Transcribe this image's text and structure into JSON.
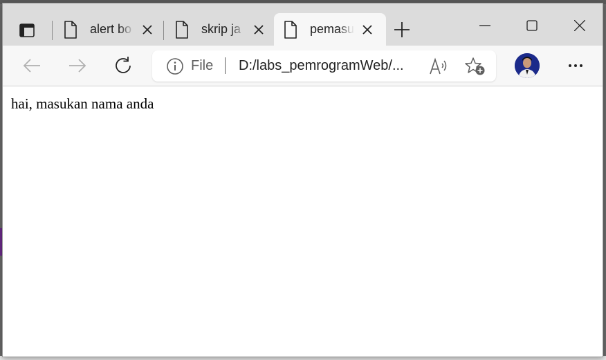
{
  "browser": {
    "tabs": [
      {
        "title": "alert bo",
        "active": false
      },
      {
        "title": "skrip ja",
        "active": false
      },
      {
        "title": "pemasu",
        "active": true
      }
    ],
    "address_bar": {
      "scheme_label": "File",
      "url": "D:/labs_pemrogramWeb/..."
    },
    "icons": {
      "tab_actions": "tab-actions-icon",
      "document": "document-icon",
      "close": "close-icon",
      "new_tab": "plus-icon",
      "minimize": "minimize-icon",
      "maximize": "maximize-icon",
      "back": "back-arrow-icon",
      "forward": "forward-arrow-icon",
      "refresh": "refresh-icon",
      "info": "info-icon",
      "read_aloud": "read-aloud-icon",
      "favorites": "add-favorite-icon",
      "profile": "profile-avatar",
      "more": "more-icon"
    }
  },
  "page": {
    "text": "hai, masukan nama anda"
  },
  "colors": {
    "titlebar_bg": "#dcdcdc",
    "toolbar_bg": "#f7f7f7",
    "active_tab_bg": "#f7f7f7",
    "content_bg": "#ffffff",
    "avatar_bg": "#1b2a8a"
  }
}
